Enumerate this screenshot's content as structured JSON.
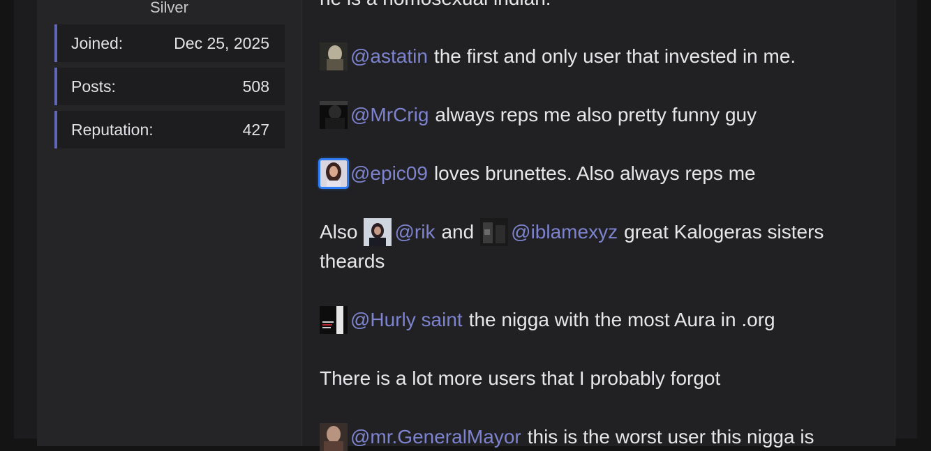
{
  "profile": {
    "rank": "Silver",
    "stats": [
      {
        "label": "Joined:",
        "value": "Dec 25, 2025"
      },
      {
        "label": "Posts:",
        "value": "508"
      },
      {
        "label": "Reputation:",
        "value": "427"
      }
    ]
  },
  "post": {
    "top_partial": "he is a homosexual indian.",
    "lines": [
      {
        "mention": "@astatin",
        "text": "the first and only user that invested in me."
      },
      {
        "mention": "@MrCrig",
        "text": "always reps me also pretty funny guy"
      },
      {
        "mention": "@epic09",
        "text": "loves brunettes. Also always reps me"
      },
      {
        "prefix": "Also",
        "mention": "@rik",
        "middle": "and",
        "mention2": "@iblamexyz",
        "text": "great Kalogeras sisters",
        "text_line2": "theards"
      },
      {
        "mention": "@Hurly saint",
        "text": "the nigga with the most Aura in .org"
      },
      {
        "text": "There is a lot more users that I probably forgot"
      },
      {
        "mention": "@mr.GeneralMayor",
        "text": "this is the worst user this nigga is"
      }
    ]
  },
  "colors": {
    "accent": "#6067b3",
    "mention": "#7d83cf",
    "text": "#e7e7ea",
    "avatar_ring": "#2f7df6"
  },
  "icons": {
    "avatar_astatin": "avatar-image",
    "avatar_mrcrig": "avatar-image",
    "avatar_epic09": "avatar-image",
    "avatar_rik": "avatar-image",
    "avatar_iblamexyz": "avatar-image",
    "avatar_hurly": "avatar-image",
    "avatar_mrgeneralmayor": "avatar-image"
  }
}
